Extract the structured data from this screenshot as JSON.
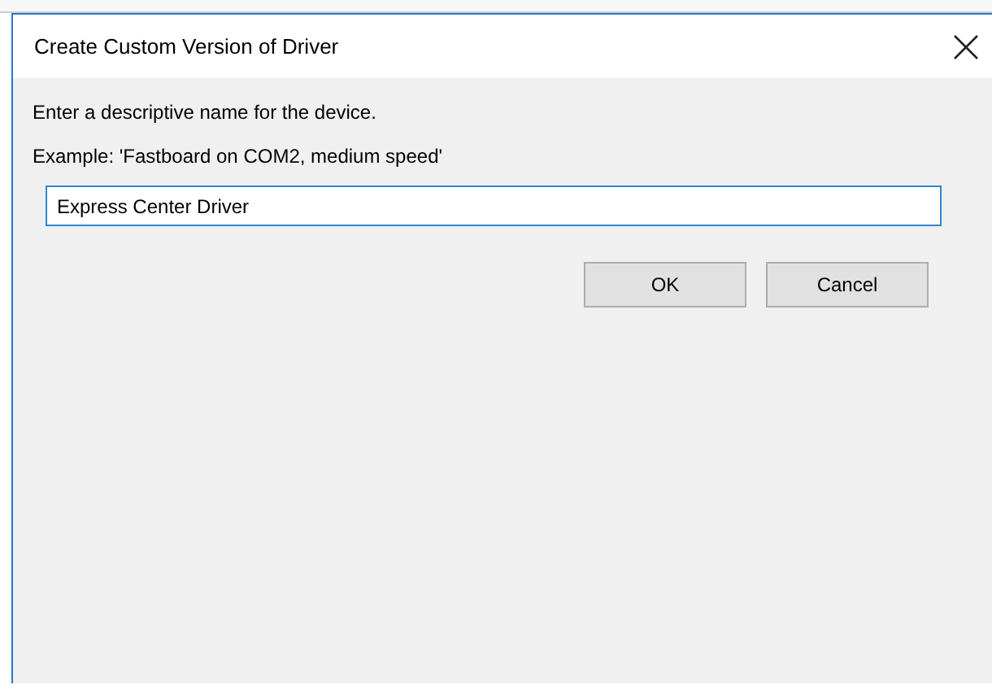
{
  "window": {
    "title": "Create Custom Version of Driver"
  },
  "prompt": "Enter a descriptive name for the device.",
  "example": "Example: 'Fastboard on COM2, medium speed'",
  "name_field": {
    "value": "Express Center Driver"
  },
  "buttons": [
    {
      "label": "OK"
    },
    {
      "label": "Cancel"
    }
  ]
}
